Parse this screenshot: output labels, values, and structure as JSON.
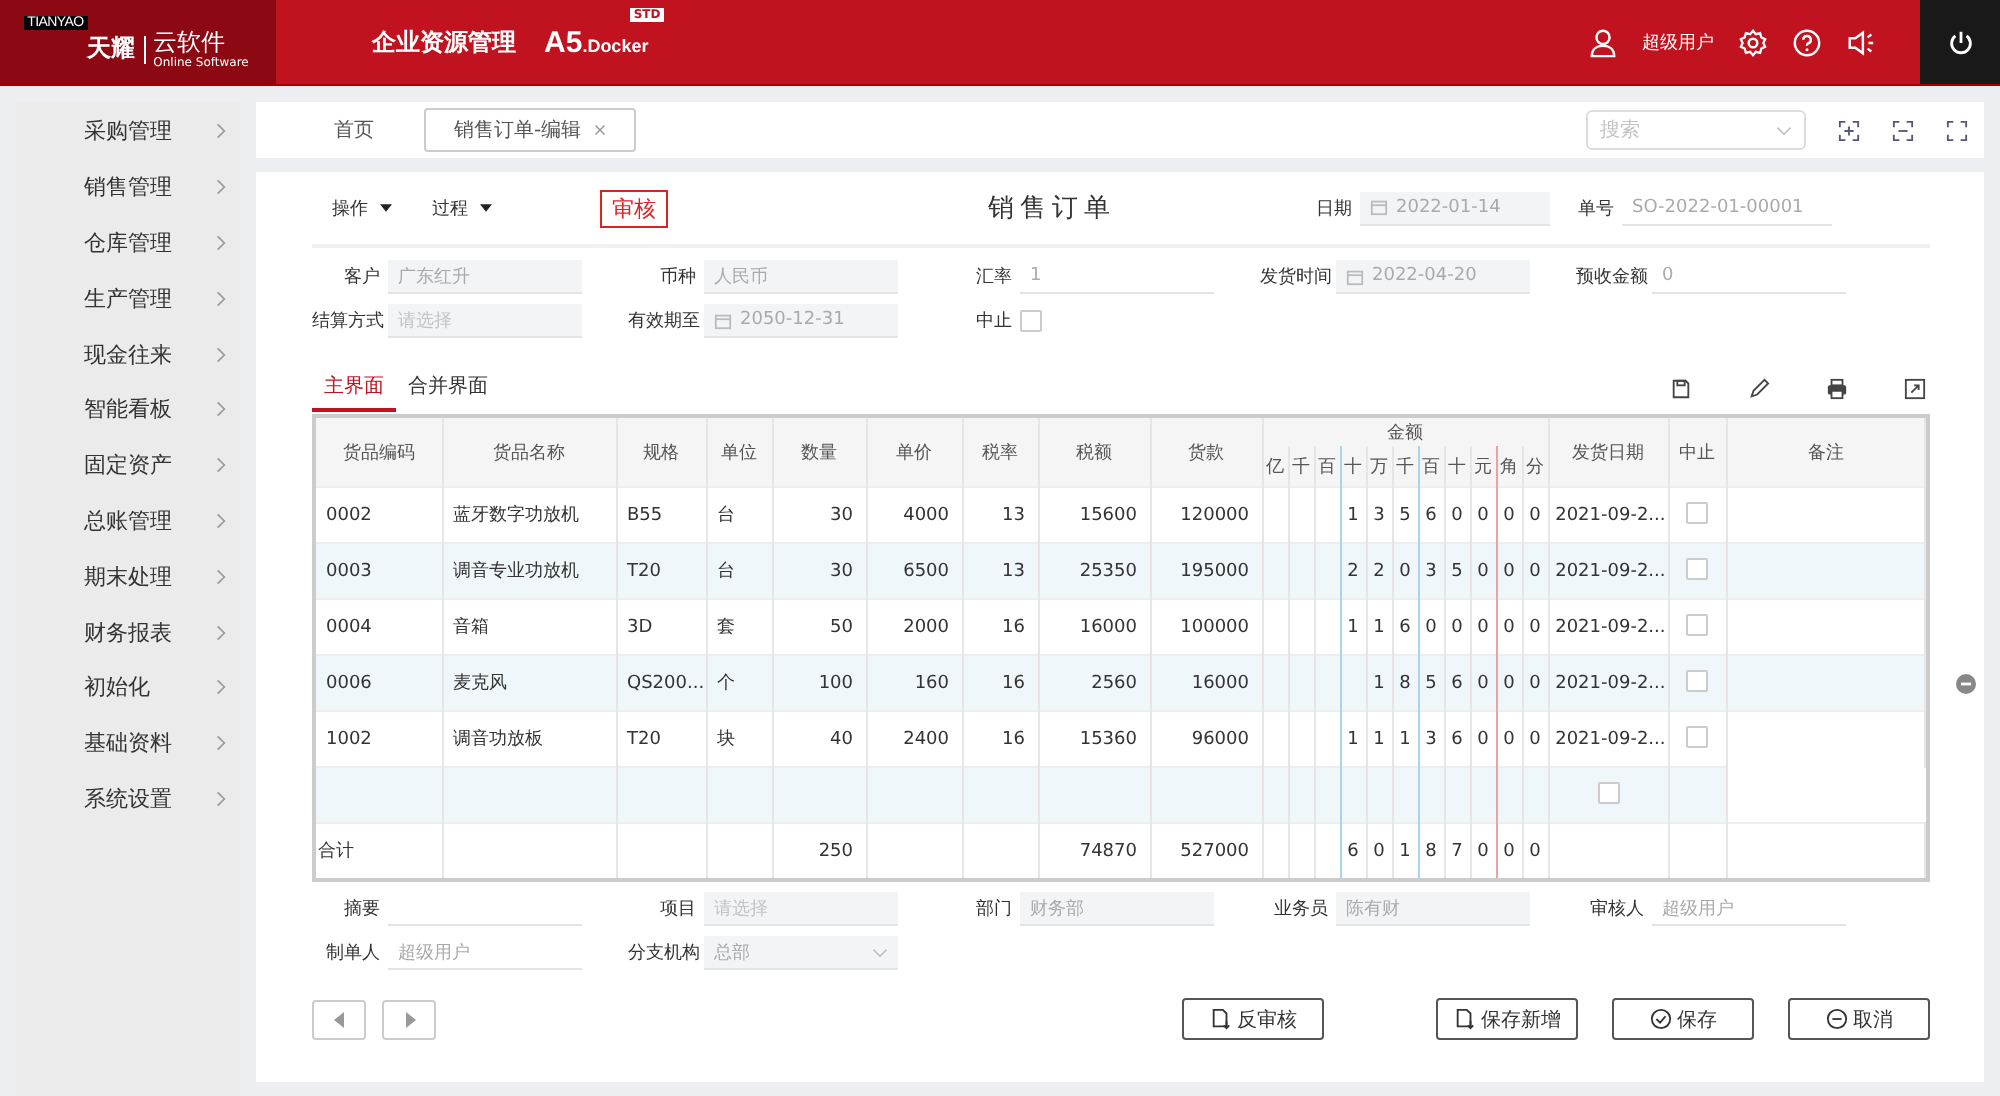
{
  "header": {
    "logo": {
      "badge": "TIANYAO",
      "brand": "天耀",
      "product": "云软件",
      "tagline": "Online Software"
    },
    "app_title": "企业资源管理",
    "version": "A5",
    "edition_suffix": ".Docker",
    "edition_badge": "STD",
    "user": "超级用户"
  },
  "sidebar": {
    "items": [
      {
        "label": "采购管理"
      },
      {
        "label": "销售管理"
      },
      {
        "label": "仓库管理"
      },
      {
        "label": "生产管理"
      },
      {
        "label": "现金往来"
      },
      {
        "label": "智能看板"
      },
      {
        "label": "固定资产"
      },
      {
        "label": "总账管理"
      },
      {
        "label": "期末处理"
      },
      {
        "label": "财务报表"
      },
      {
        "label": "初始化"
      },
      {
        "label": "基础资料"
      },
      {
        "label": "系统设置"
      }
    ]
  },
  "tabs": [
    {
      "label": "首页",
      "selected": false
    },
    {
      "label": "销售订单-编辑",
      "selected": true
    }
  ],
  "search": {
    "placeholder": "搜索"
  },
  "toolbar": {
    "menus": [
      "操作",
      "过程"
    ],
    "stamp": "审核",
    "title": "销售订单",
    "date": {
      "label": "日期",
      "value": "2022-01-14"
    },
    "number": {
      "label": "单号",
      "value": "SO-2022-01-00001"
    }
  },
  "form_fields": [
    {
      "label": "客户",
      "kind": "text",
      "value": "广东红升",
      "disabled": true
    },
    {
      "label": "币种",
      "kind": "text",
      "value": "人民币",
      "disabled": true
    },
    {
      "label": "汇率",
      "kind": "text",
      "value": "1",
      "disabled": false
    },
    {
      "label": "发货时间",
      "kind": "date",
      "value": "2022-04-20",
      "disabled": true
    },
    {
      "label": "预收金额",
      "kind": "text",
      "value": "0",
      "disabled": false
    },
    {
      "label": "结算方式",
      "kind": "text",
      "placeholder": "请选择",
      "disabled": true
    },
    {
      "label": "有效期至",
      "kind": "date",
      "value": "2050-12-31",
      "disabled": true
    },
    {
      "label": "中止",
      "kind": "checkbox",
      "checked": false
    }
  ],
  "subtabs": [
    {
      "label": "主界面",
      "selected": true
    },
    {
      "label": "合并界面",
      "selected": false
    }
  ],
  "table": {
    "columns": [
      "货品编码",
      "货品名称",
      "规格",
      "单位",
      "数量",
      "单价",
      "税率",
      "税额",
      "货款"
    ],
    "amount_header": "金额",
    "digit_units": [
      "亿",
      "千",
      "百",
      "十",
      "万",
      "千",
      "百",
      "十",
      "元",
      "角",
      "分"
    ],
    "trailing_columns": [
      "发货日期",
      "中止",
      "备注"
    ],
    "rows": [
      {
        "code": "0002",
        "name": "蓝牙数字功放机",
        "spec": "B55",
        "unit": "台",
        "qty": "30",
        "price": "4000",
        "rate": "13",
        "tax": "15600",
        "amount": "120000",
        "digits": [
          "1",
          "3",
          "5",
          "6",
          "0",
          "0",
          "0",
          "0"
        ],
        "ship_date": "2021-09-2...",
        "stopped": false
      },
      {
        "code": "0003",
        "name": "调音专业功放机",
        "spec": "T20",
        "unit": "台",
        "qty": "30",
        "price": "6500",
        "rate": "13",
        "tax": "25350",
        "amount": "195000",
        "digits": [
          "2",
          "2",
          "0",
          "3",
          "5",
          "0",
          "0",
          "0"
        ],
        "ship_date": "2021-09-2...",
        "stopped": false
      },
      {
        "code": "0004",
        "name": "音箱",
        "spec": "3D",
        "unit": "套",
        "qty": "50",
        "price": "2000",
        "rate": "16",
        "tax": "16000",
        "amount": "100000",
        "digits": [
          "1",
          "1",
          "6",
          "0",
          "0",
          "0",
          "0",
          "0"
        ],
        "ship_date": "2021-09-2...",
        "stopped": false
      },
      {
        "code": "0006",
        "name": "麦克风",
        "spec": "QS200...",
        "unit": "个",
        "qty": "100",
        "price": "160",
        "rate": "16",
        "tax": "2560",
        "amount": "16000",
        "digits": [
          "1",
          "8",
          "5",
          "6",
          "0",
          "0",
          "0"
        ],
        "ship_date": "2021-09-2...",
        "stopped": false
      },
      {
        "code": "1002",
        "name": "调音功放板",
        "spec": "T20",
        "unit": "块",
        "qty": "40",
        "price": "2400",
        "rate": "16",
        "tax": "15360",
        "amount": "96000",
        "digits": [
          "1",
          "1",
          "1",
          "3",
          "6",
          "0",
          "0",
          "0"
        ],
        "ship_date": "2021-09-2...",
        "stopped": false
      }
    ],
    "empty_row": {
      "stopped": false
    },
    "total": {
      "label": "合计",
      "qty": "250",
      "tax": "74870",
      "amount": "527000",
      "digits": [
        "6",
        "0",
        "1",
        "8",
        "7",
        "0",
        "0",
        "0"
      ]
    }
  },
  "footer_fields": [
    {
      "label": "摘要",
      "kind": "text",
      "disabled": false
    },
    {
      "label": "项目",
      "kind": "text",
      "placeholder": "请选择",
      "disabled": true
    },
    {
      "label": "部门",
      "kind": "text",
      "value": "财务部",
      "disabled": true
    },
    {
      "label": "业务员",
      "kind": "text",
      "value": "陈有财",
      "disabled": true
    },
    {
      "label": "审核人",
      "kind": "text",
      "value": "超级用户",
      "disabled": false
    },
    {
      "label": "制单人",
      "kind": "text",
      "value": "超级用户",
      "disabled": false
    },
    {
      "label": "分支机构",
      "kind": "select",
      "value": "总部",
      "disabled": true
    }
  ],
  "buttons": [
    {
      "label": "反审核"
    },
    {
      "label": "保存新增"
    },
    {
      "label": "保存"
    },
    {
      "label": "取消"
    }
  ]
}
